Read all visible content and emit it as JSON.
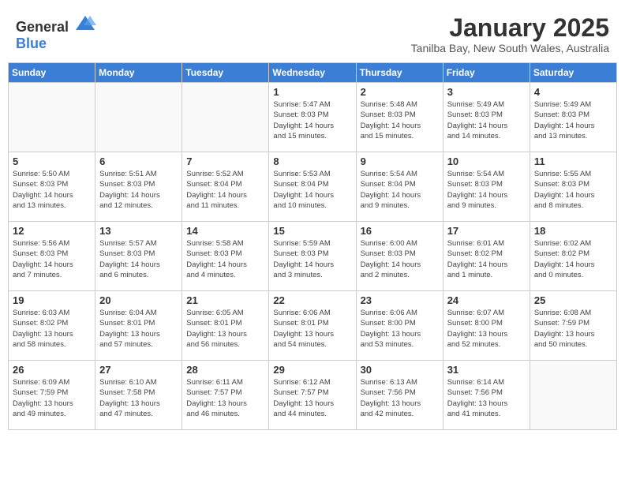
{
  "header": {
    "logo_general": "General",
    "logo_blue": "Blue",
    "title": "January 2025",
    "subtitle": "Tanilba Bay, New South Wales, Australia"
  },
  "weekdays": [
    "Sunday",
    "Monday",
    "Tuesday",
    "Wednesday",
    "Thursday",
    "Friday",
    "Saturday"
  ],
  "weeks": [
    [
      {
        "day": "",
        "info": ""
      },
      {
        "day": "",
        "info": ""
      },
      {
        "day": "",
        "info": ""
      },
      {
        "day": "1",
        "info": "Sunrise: 5:47 AM\nSunset: 8:03 PM\nDaylight: 14 hours\nand 15 minutes."
      },
      {
        "day": "2",
        "info": "Sunrise: 5:48 AM\nSunset: 8:03 PM\nDaylight: 14 hours\nand 15 minutes."
      },
      {
        "day": "3",
        "info": "Sunrise: 5:49 AM\nSunset: 8:03 PM\nDaylight: 14 hours\nand 14 minutes."
      },
      {
        "day": "4",
        "info": "Sunrise: 5:49 AM\nSunset: 8:03 PM\nDaylight: 14 hours\nand 13 minutes."
      }
    ],
    [
      {
        "day": "5",
        "info": "Sunrise: 5:50 AM\nSunset: 8:03 PM\nDaylight: 14 hours\nand 13 minutes."
      },
      {
        "day": "6",
        "info": "Sunrise: 5:51 AM\nSunset: 8:03 PM\nDaylight: 14 hours\nand 12 minutes."
      },
      {
        "day": "7",
        "info": "Sunrise: 5:52 AM\nSunset: 8:04 PM\nDaylight: 14 hours\nand 11 minutes."
      },
      {
        "day": "8",
        "info": "Sunrise: 5:53 AM\nSunset: 8:04 PM\nDaylight: 14 hours\nand 10 minutes."
      },
      {
        "day": "9",
        "info": "Sunrise: 5:54 AM\nSunset: 8:04 PM\nDaylight: 14 hours\nand 9 minutes."
      },
      {
        "day": "10",
        "info": "Sunrise: 5:54 AM\nSunset: 8:03 PM\nDaylight: 14 hours\nand 9 minutes."
      },
      {
        "day": "11",
        "info": "Sunrise: 5:55 AM\nSunset: 8:03 PM\nDaylight: 14 hours\nand 8 minutes."
      }
    ],
    [
      {
        "day": "12",
        "info": "Sunrise: 5:56 AM\nSunset: 8:03 PM\nDaylight: 14 hours\nand 7 minutes."
      },
      {
        "day": "13",
        "info": "Sunrise: 5:57 AM\nSunset: 8:03 PM\nDaylight: 14 hours\nand 6 minutes."
      },
      {
        "day": "14",
        "info": "Sunrise: 5:58 AM\nSunset: 8:03 PM\nDaylight: 14 hours\nand 4 minutes."
      },
      {
        "day": "15",
        "info": "Sunrise: 5:59 AM\nSunset: 8:03 PM\nDaylight: 14 hours\nand 3 minutes."
      },
      {
        "day": "16",
        "info": "Sunrise: 6:00 AM\nSunset: 8:03 PM\nDaylight: 14 hours\nand 2 minutes."
      },
      {
        "day": "17",
        "info": "Sunrise: 6:01 AM\nSunset: 8:02 PM\nDaylight: 14 hours\nand 1 minute."
      },
      {
        "day": "18",
        "info": "Sunrise: 6:02 AM\nSunset: 8:02 PM\nDaylight: 14 hours\nand 0 minutes."
      }
    ],
    [
      {
        "day": "19",
        "info": "Sunrise: 6:03 AM\nSunset: 8:02 PM\nDaylight: 13 hours\nand 58 minutes."
      },
      {
        "day": "20",
        "info": "Sunrise: 6:04 AM\nSunset: 8:01 PM\nDaylight: 13 hours\nand 57 minutes."
      },
      {
        "day": "21",
        "info": "Sunrise: 6:05 AM\nSunset: 8:01 PM\nDaylight: 13 hours\nand 56 minutes."
      },
      {
        "day": "22",
        "info": "Sunrise: 6:06 AM\nSunset: 8:01 PM\nDaylight: 13 hours\nand 54 minutes."
      },
      {
        "day": "23",
        "info": "Sunrise: 6:06 AM\nSunset: 8:00 PM\nDaylight: 13 hours\nand 53 minutes."
      },
      {
        "day": "24",
        "info": "Sunrise: 6:07 AM\nSunset: 8:00 PM\nDaylight: 13 hours\nand 52 minutes."
      },
      {
        "day": "25",
        "info": "Sunrise: 6:08 AM\nSunset: 7:59 PM\nDaylight: 13 hours\nand 50 minutes."
      }
    ],
    [
      {
        "day": "26",
        "info": "Sunrise: 6:09 AM\nSunset: 7:59 PM\nDaylight: 13 hours\nand 49 minutes."
      },
      {
        "day": "27",
        "info": "Sunrise: 6:10 AM\nSunset: 7:58 PM\nDaylight: 13 hours\nand 47 minutes."
      },
      {
        "day": "28",
        "info": "Sunrise: 6:11 AM\nSunset: 7:57 PM\nDaylight: 13 hours\nand 46 minutes."
      },
      {
        "day": "29",
        "info": "Sunrise: 6:12 AM\nSunset: 7:57 PM\nDaylight: 13 hours\nand 44 minutes."
      },
      {
        "day": "30",
        "info": "Sunrise: 6:13 AM\nSunset: 7:56 PM\nDaylight: 13 hours\nand 42 minutes."
      },
      {
        "day": "31",
        "info": "Sunrise: 6:14 AM\nSunset: 7:56 PM\nDaylight: 13 hours\nand 41 minutes."
      },
      {
        "day": "",
        "info": ""
      }
    ]
  ]
}
